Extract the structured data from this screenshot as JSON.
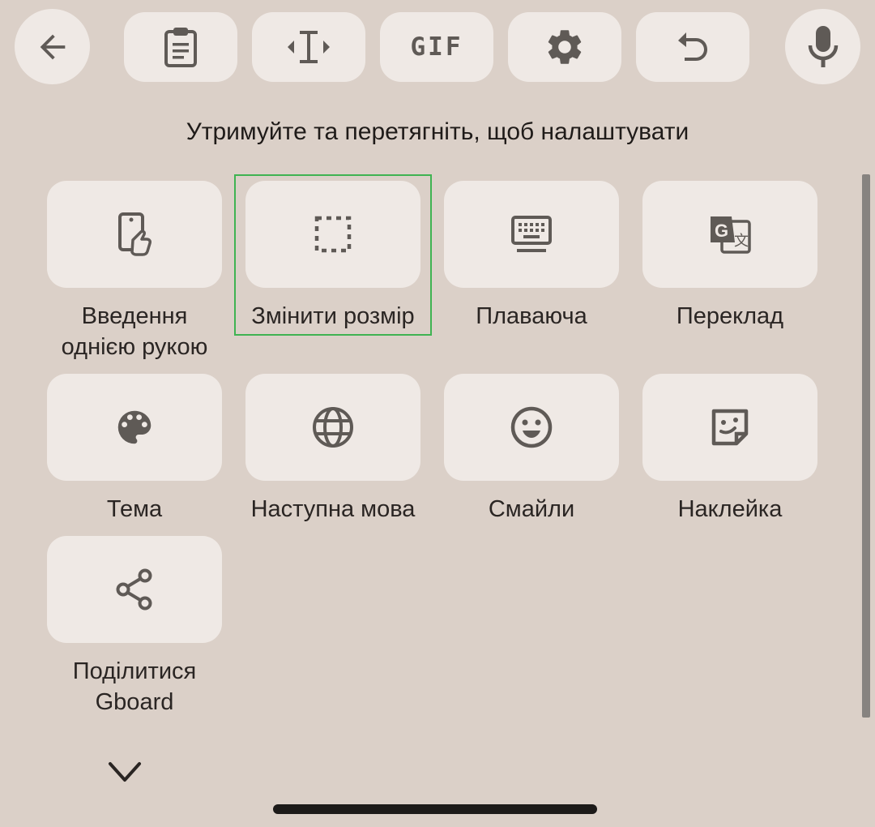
{
  "toolbar": {
    "back": "back-arrow-icon",
    "items": [
      {
        "name": "clipboard",
        "icon": "clipboard-icon"
      },
      {
        "name": "text-editing",
        "icon": "text-cursor-icon"
      },
      {
        "name": "gif",
        "label": "GIF"
      },
      {
        "name": "settings",
        "icon": "gear-icon"
      },
      {
        "name": "undo",
        "icon": "undo-icon"
      }
    ],
    "voice": "microphone-icon"
  },
  "hint": "Утримуйте та перетягніть, щоб налаштувати",
  "tiles": [
    {
      "label": "Введення\nоднією рукою",
      "icon": "one-handed-icon"
    },
    {
      "label": "Змінити розмір",
      "icon": "resize-icon",
      "selected": true
    },
    {
      "label": "Плаваюча",
      "icon": "floating-keyboard-icon"
    },
    {
      "label": "Переклад",
      "icon": "translate-icon"
    },
    {
      "label": "Тема",
      "icon": "palette-icon"
    },
    {
      "label": "Наступна мова",
      "icon": "globe-icon"
    },
    {
      "label": "Смайли",
      "icon": "smiley-icon"
    },
    {
      "label": "Наклейка",
      "icon": "sticker-icon"
    },
    {
      "label": "Поділитися\nGboard",
      "icon": "share-icon"
    }
  ],
  "colors": {
    "background": "#dbd0c8",
    "tile": "#efe9e5",
    "icon": "#5f5a56",
    "selection": "#3fb352"
  }
}
